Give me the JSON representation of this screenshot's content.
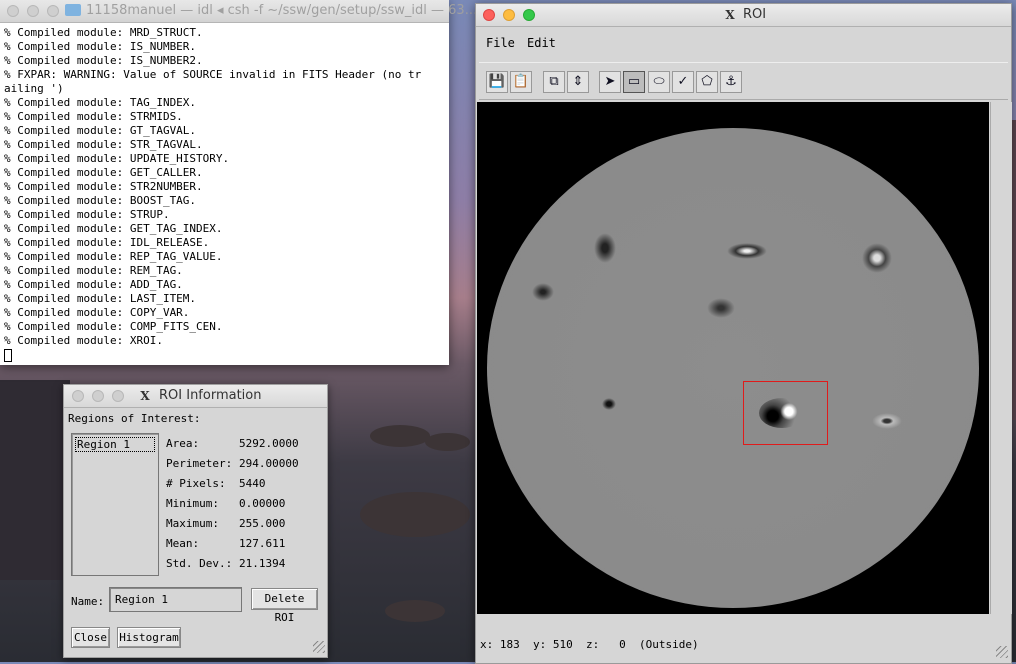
{
  "terminal": {
    "title": "11158manuel — idl ◂ csh -f ~/ssw/gen/setup/ssw_idl — 63...",
    "lines": [
      "% Compiled module: MRD_STRUCT.",
      "% Compiled module: IS_NUMBER.",
      "% Compiled module: IS_NUMBER2.",
      "% FXPAR: WARNING: Value of SOURCE invalid in FITS Header (no tr",
      "ailing ')",
      "% Compiled module: TAG_INDEX.",
      "% Compiled module: STRMIDS.",
      "% Compiled module: GT_TAGVAL.",
      "% Compiled module: STR_TAGVAL.",
      "% Compiled module: UPDATE_HISTORY.",
      "% Compiled module: GET_CALLER.",
      "% Compiled module: STR2NUMBER.",
      "% Compiled module: BOOST_TAG.",
      "% Compiled module: STRUP.",
      "% Compiled module: GET_TAG_INDEX.",
      "% Compiled module: IDL_RELEASE.",
      "% Compiled module: REP_TAG_VALUE.",
      "% Compiled module: REM_TAG.",
      "% Compiled module: ADD_TAG.",
      "% Compiled module: LAST_ITEM.",
      "% Compiled module: COPY_VAR.",
      "% Compiled module: COMP_FITS_CEN.",
      "% Compiled module: XROI."
    ]
  },
  "roi_info": {
    "title": "ROI Information",
    "regions_label": "Regions of Interest:",
    "regions": [
      "Region 1"
    ],
    "stats": [
      {
        "label": "Area:",
        "value": "5292.0000"
      },
      {
        "label": "Perimeter:",
        "value": "294.00000"
      },
      {
        "label": "# Pixels:",
        "value": "5440"
      },
      {
        "label": "Minimum:",
        "value": "0.00000"
      },
      {
        "label": "Maximum:",
        "value": "255.000"
      },
      {
        "label": "Mean:",
        "value": "127.611"
      },
      {
        "label": "Std. Dev.:",
        "value": "21.1394"
      }
    ],
    "name_label": "Name:",
    "name_value": "Region 1",
    "delete_label": "Delete ROI",
    "close_label": "Close",
    "histogram_label": "Histogram"
  },
  "roi_window": {
    "title": "ROI",
    "menu": {
      "file": "File",
      "edit": "Edit"
    },
    "status": {
      "x_label": "x:",
      "x": "183",
      "y_label": "y:",
      "y": "510",
      "z_label": "z:",
      "z": "0",
      "note": "(Outside)"
    }
  },
  "icons": [
    "save-icon",
    "save-as-icon",
    "copy-icon",
    "flip-icon",
    "arrow-select-icon",
    "rectangle-icon",
    "ellipse-icon",
    "freehand-icon",
    "polygon-icon",
    "point-icon"
  ]
}
